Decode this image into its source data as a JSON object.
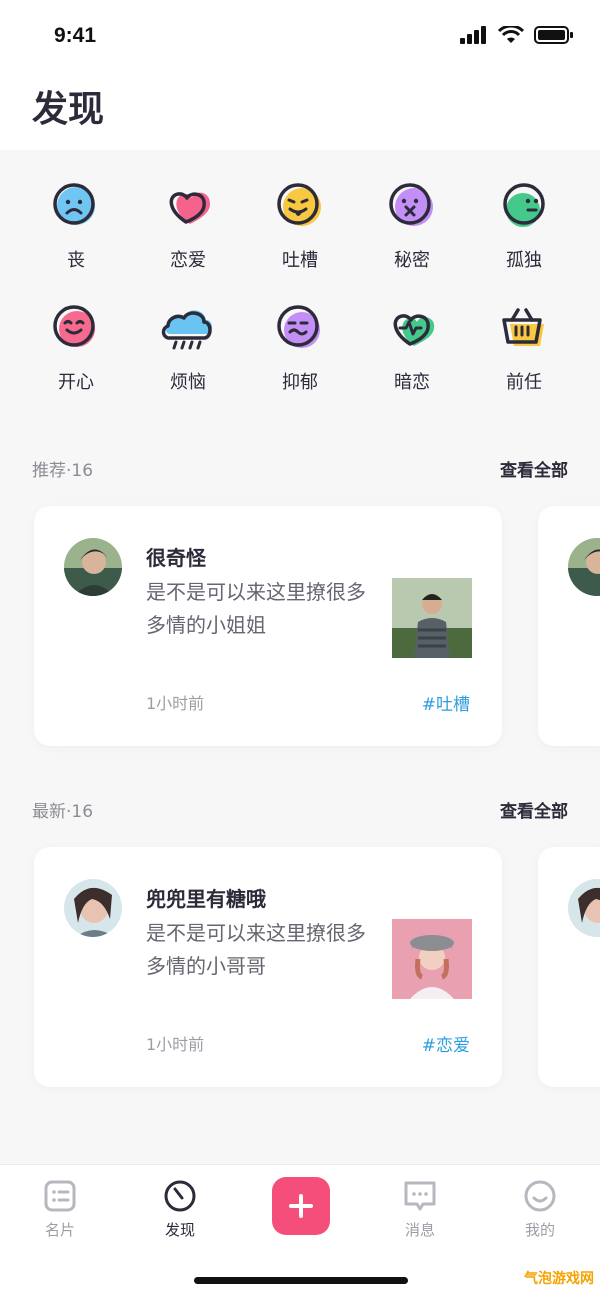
{
  "status": {
    "time": "9:41"
  },
  "header": {
    "title": "发现"
  },
  "moods": [
    {
      "label": "丧",
      "icon": "sad-face-icon"
    },
    {
      "label": "恋爱",
      "icon": "heart-icon"
    },
    {
      "label": "吐槽",
      "icon": "tongue-face-icon"
    },
    {
      "label": "秘密",
      "icon": "secret-face-icon"
    },
    {
      "label": "孤独",
      "icon": "lonely-face-icon"
    },
    {
      "label": "开心",
      "icon": "happy-face-icon"
    },
    {
      "label": "烦恼",
      "icon": "rain-cloud-icon"
    },
    {
      "label": "抑郁",
      "icon": "depressed-face-icon"
    },
    {
      "label": "暗恋",
      "icon": "crush-heart-icon"
    },
    {
      "label": "前任",
      "icon": "basket-icon"
    }
  ],
  "recommend": {
    "title": "推荐·16",
    "view_all": "查看全部",
    "card": {
      "name": "很奇怪",
      "text": "是不是可以来这里撩很多多情的小姐姐",
      "time": "1小时前",
      "tag": "#吐槽"
    }
  },
  "latest": {
    "title": "最新·16",
    "view_all": "查看全部",
    "card": {
      "name": "兜兜里有糖哦",
      "text": "是不是可以来这里撩很多多情的小哥哥",
      "time": "1小时前",
      "tag": "#恋爱"
    }
  },
  "tabs": [
    {
      "label": "名片",
      "icon": "card-icon"
    },
    {
      "label": "发现",
      "icon": "compass-icon"
    },
    {
      "label": "消息",
      "icon": "message-icon"
    },
    {
      "label": "我的",
      "icon": "profile-icon"
    }
  ],
  "watermark": "气泡游戏网",
  "colors": {
    "accent": "#f54e7b",
    "tag": "#2d9ee0"
  }
}
